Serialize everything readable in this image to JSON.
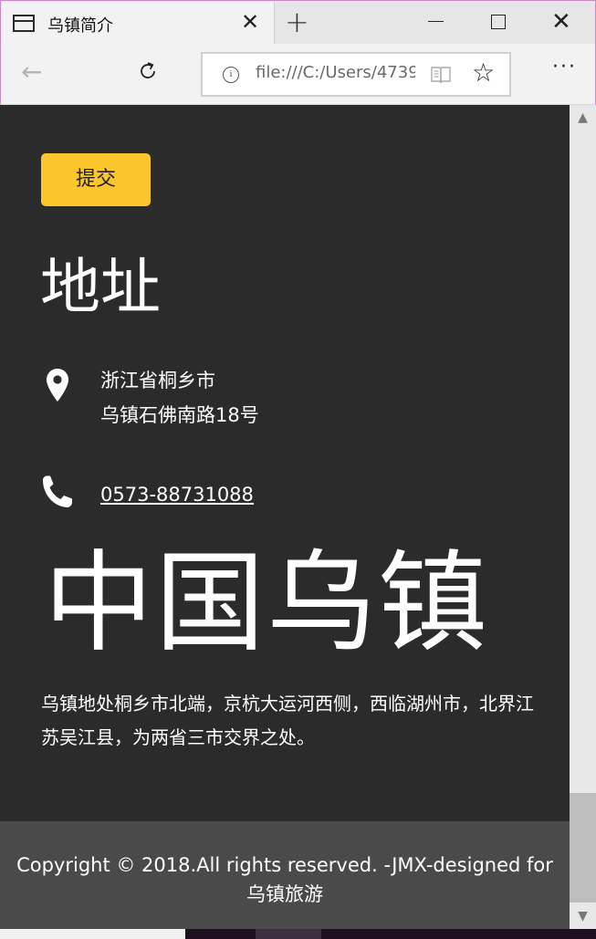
{
  "browser": {
    "tab_title": "乌镇简介",
    "tab_close": "✕",
    "new_tab": "+",
    "url": "file:///C:/Users/4739",
    "info_symbol": "i",
    "back_symbol": "←",
    "star_symbol": "☆",
    "more_symbol": "···",
    "window_close": "✕"
  },
  "page": {
    "submit_label": "提交",
    "address_heading": "地址",
    "address_line1": "浙江省桐乡市",
    "address_line2": "乌镇石佛南路18号",
    "phone": "0573-88731088",
    "big_title": "中国乌镇",
    "description": "乌镇地处桐乡市北端，京杭大运河西侧，西临湖州市，北界江苏吴江县，为两省三市交界之处。",
    "accent_color": "#fbc52c",
    "background_color": "#2b2b2b"
  },
  "footer": {
    "copyright": "Copyright © 2018.All rights reserved. -JMX-designed for乌镇旅游"
  },
  "scrollbar": {
    "up_symbol": "▲",
    "down_symbol": "▼"
  }
}
